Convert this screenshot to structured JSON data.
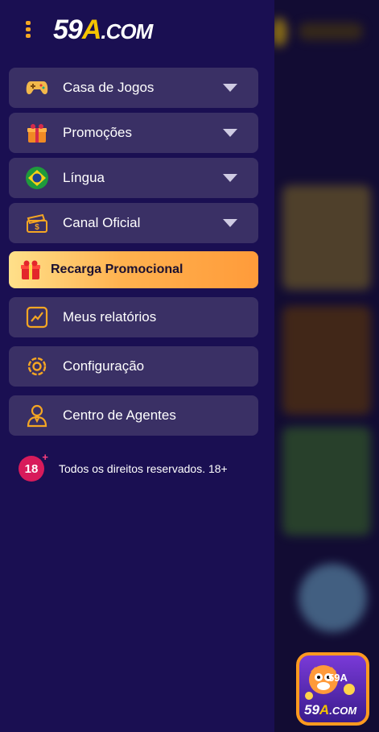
{
  "logo": {
    "part1": "59",
    "part2": "A",
    "part3": ".COM"
  },
  "menu": {
    "items": [
      {
        "label": "Casa de Jogos",
        "icon": "gamepad-icon"
      },
      {
        "label": "Promoções",
        "icon": "gift-box-icon"
      },
      {
        "label": "Língua",
        "icon": "brazil-flag-icon"
      },
      {
        "label": "Canal Oficial",
        "icon": "ticket-icon"
      }
    ],
    "promo": {
      "label": "Recarga Promocional",
      "icon": "red-gift-icon"
    },
    "links": [
      {
        "label": "Meus relatórios",
        "icon": "chart-icon"
      },
      {
        "label": "Configuração",
        "icon": "gear-icon"
      },
      {
        "label": "Centro de Agentes",
        "icon": "agent-icon"
      }
    ]
  },
  "footer": {
    "badge": "18",
    "badge_plus": "+",
    "text": "Todos os direitos reservados. 18+"
  },
  "app_badge": {
    "number": "59A",
    "brand_part1": "59",
    "brand_part2": "A",
    "brand_part3": ".COM"
  },
  "colors": {
    "accent": "#f5a623",
    "drawer_bg": "#1a0f52",
    "item_bg": "#3a3065"
  }
}
